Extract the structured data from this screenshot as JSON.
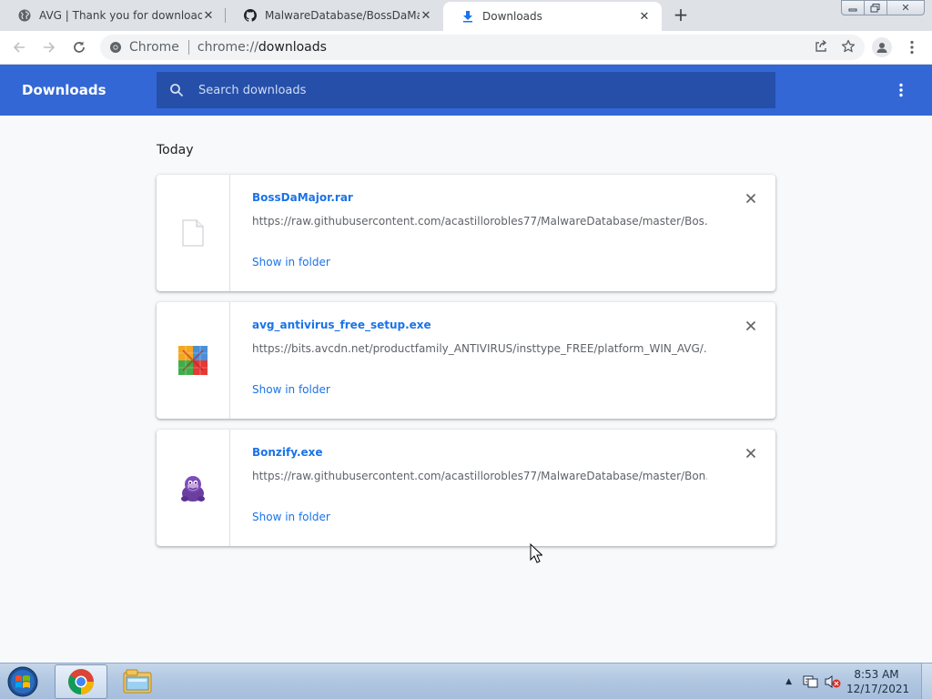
{
  "tabs": [
    {
      "title": "AVG | Thank you for downloading",
      "icon": "globe-icon"
    },
    {
      "title": "MalwareDatabase/BossDaMajor.ra",
      "icon": "github-icon"
    },
    {
      "title": "Downloads",
      "icon": "download-icon"
    }
  ],
  "toolbar": {
    "site_label": "Chrome",
    "url_scheme": "chrome://",
    "url_host": "downloads"
  },
  "downloads": {
    "title": "Downloads",
    "search_placeholder": "Search downloads",
    "section_date": "Today",
    "items": [
      {
        "filename": "BossDaMajor.rar",
        "url": "https://raw.githubusercontent.com/acastillorobles77/MalwareDatabase/master/Bos...",
        "action": "Show in folder",
        "icon": "generic-file-icon"
      },
      {
        "filename": "avg_antivirus_free_setup.exe",
        "url": "https://bits.avcdn.net/productfamily_ANTIVIRUS/insttype_FREE/platform_WIN_AVG/...",
        "action": "Show in folder",
        "icon": "avg-logo-icon"
      },
      {
        "filename": "Bonzify.exe",
        "url": "https://raw.githubusercontent.com/acastillorobles77/MalwareDatabase/master/Bon...",
        "action": "Show in folder",
        "icon": "bonzi-gorilla-icon"
      }
    ]
  },
  "taskbar": {
    "apps": [
      "chrome-icon",
      "file-explorer-icon"
    ],
    "time": "8:53 AM",
    "date": "12/17/2021"
  },
  "colors": {
    "header_blue": "#3367d6",
    "search_blue": "#254fa8",
    "link_blue": "#1a73e8"
  }
}
